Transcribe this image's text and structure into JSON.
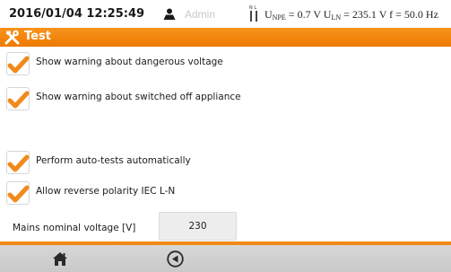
{
  "status_bar": {
    "datetime": "2016/01/04 12:25:49",
    "user": "Admin",
    "measurement": {
      "une_label": "U",
      "une_sub": "NPE",
      "une_value": " = 0.7 V ",
      "uln_label": "U",
      "uln_sub": "LN",
      "uln_value": " = 235.1 V ",
      "f_label": "f = 50.0 Hz"
    },
    "plug_icon_label": "N L"
  },
  "title_bar": {
    "title": "Test",
    "icon": "tools-icon"
  },
  "options": [
    {
      "label": "Show warning about dangerous voltage",
      "checked": true
    },
    {
      "label": "Show warning about switched off appliance",
      "checked": true
    },
    {
      "label": "Perform auto-tests automatically",
      "checked": true
    },
    {
      "label": "Allow reverse polarity IEC L-N",
      "checked": true
    }
  ],
  "mains_voltage": {
    "label": "Mains nominal voltage [V]",
    "value": "230"
  },
  "bottom_bar": {
    "buttons": [
      "home-icon",
      "back-icon"
    ]
  },
  "colors": {
    "accent": "#f28a14",
    "check": "#f08a1c",
    "bottom_bar": "#cfcfcf",
    "field_bg": "#ededed"
  }
}
